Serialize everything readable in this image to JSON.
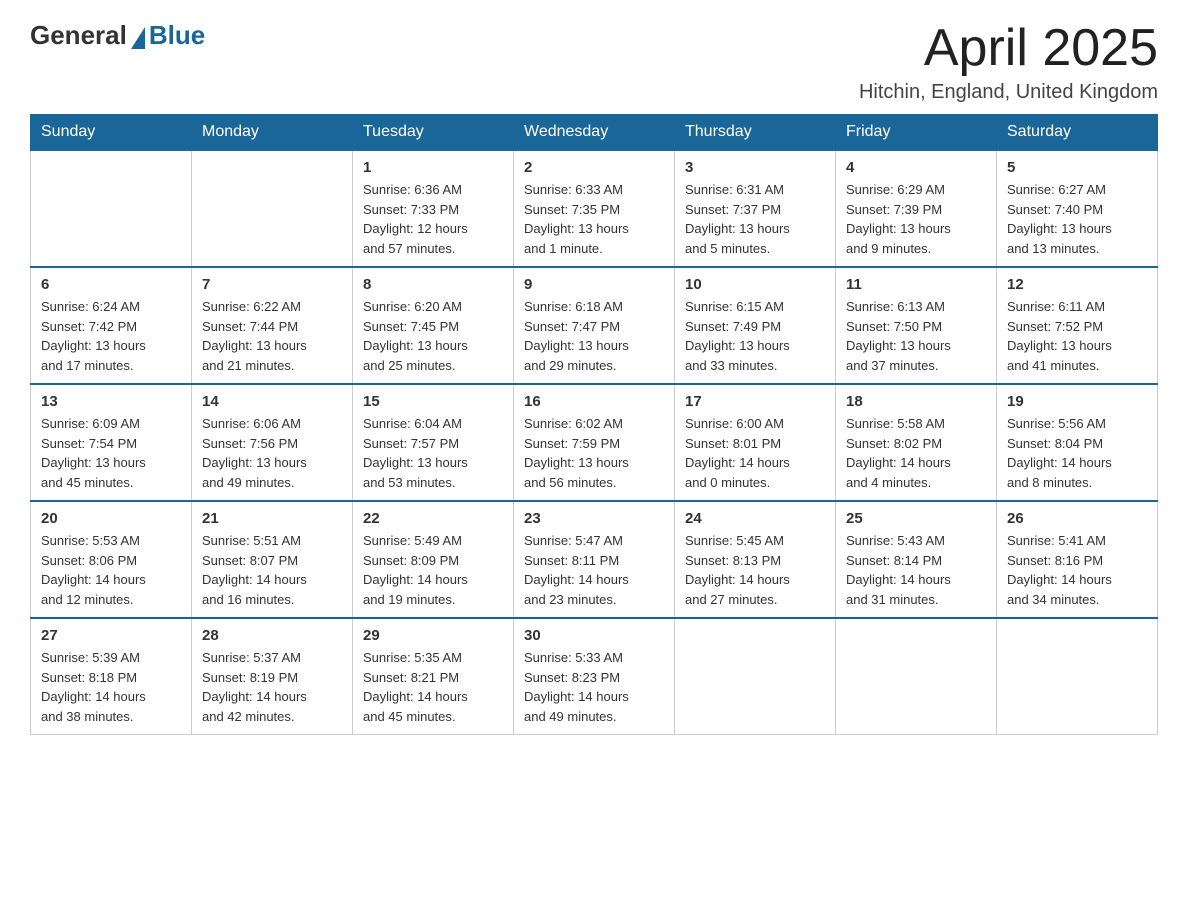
{
  "header": {
    "logo": {
      "general": "General",
      "blue": "Blue"
    },
    "title": "April 2025",
    "location": "Hitchin, England, United Kingdom"
  },
  "days_of_week": [
    "Sunday",
    "Monday",
    "Tuesday",
    "Wednesday",
    "Thursday",
    "Friday",
    "Saturday"
  ],
  "weeks": [
    [
      {
        "day": "",
        "info": ""
      },
      {
        "day": "",
        "info": ""
      },
      {
        "day": "1",
        "info": "Sunrise: 6:36 AM\nSunset: 7:33 PM\nDaylight: 12 hours\nand 57 minutes."
      },
      {
        "day": "2",
        "info": "Sunrise: 6:33 AM\nSunset: 7:35 PM\nDaylight: 13 hours\nand 1 minute."
      },
      {
        "day": "3",
        "info": "Sunrise: 6:31 AM\nSunset: 7:37 PM\nDaylight: 13 hours\nand 5 minutes."
      },
      {
        "day": "4",
        "info": "Sunrise: 6:29 AM\nSunset: 7:39 PM\nDaylight: 13 hours\nand 9 minutes."
      },
      {
        "day": "5",
        "info": "Sunrise: 6:27 AM\nSunset: 7:40 PM\nDaylight: 13 hours\nand 13 minutes."
      }
    ],
    [
      {
        "day": "6",
        "info": "Sunrise: 6:24 AM\nSunset: 7:42 PM\nDaylight: 13 hours\nand 17 minutes."
      },
      {
        "day": "7",
        "info": "Sunrise: 6:22 AM\nSunset: 7:44 PM\nDaylight: 13 hours\nand 21 minutes."
      },
      {
        "day": "8",
        "info": "Sunrise: 6:20 AM\nSunset: 7:45 PM\nDaylight: 13 hours\nand 25 minutes."
      },
      {
        "day": "9",
        "info": "Sunrise: 6:18 AM\nSunset: 7:47 PM\nDaylight: 13 hours\nand 29 minutes."
      },
      {
        "day": "10",
        "info": "Sunrise: 6:15 AM\nSunset: 7:49 PM\nDaylight: 13 hours\nand 33 minutes."
      },
      {
        "day": "11",
        "info": "Sunrise: 6:13 AM\nSunset: 7:50 PM\nDaylight: 13 hours\nand 37 minutes."
      },
      {
        "day": "12",
        "info": "Sunrise: 6:11 AM\nSunset: 7:52 PM\nDaylight: 13 hours\nand 41 minutes."
      }
    ],
    [
      {
        "day": "13",
        "info": "Sunrise: 6:09 AM\nSunset: 7:54 PM\nDaylight: 13 hours\nand 45 minutes."
      },
      {
        "day": "14",
        "info": "Sunrise: 6:06 AM\nSunset: 7:56 PM\nDaylight: 13 hours\nand 49 minutes."
      },
      {
        "day": "15",
        "info": "Sunrise: 6:04 AM\nSunset: 7:57 PM\nDaylight: 13 hours\nand 53 minutes."
      },
      {
        "day": "16",
        "info": "Sunrise: 6:02 AM\nSunset: 7:59 PM\nDaylight: 13 hours\nand 56 minutes."
      },
      {
        "day": "17",
        "info": "Sunrise: 6:00 AM\nSunset: 8:01 PM\nDaylight: 14 hours\nand 0 minutes."
      },
      {
        "day": "18",
        "info": "Sunrise: 5:58 AM\nSunset: 8:02 PM\nDaylight: 14 hours\nand 4 minutes."
      },
      {
        "day": "19",
        "info": "Sunrise: 5:56 AM\nSunset: 8:04 PM\nDaylight: 14 hours\nand 8 minutes."
      }
    ],
    [
      {
        "day": "20",
        "info": "Sunrise: 5:53 AM\nSunset: 8:06 PM\nDaylight: 14 hours\nand 12 minutes."
      },
      {
        "day": "21",
        "info": "Sunrise: 5:51 AM\nSunset: 8:07 PM\nDaylight: 14 hours\nand 16 minutes."
      },
      {
        "day": "22",
        "info": "Sunrise: 5:49 AM\nSunset: 8:09 PM\nDaylight: 14 hours\nand 19 minutes."
      },
      {
        "day": "23",
        "info": "Sunrise: 5:47 AM\nSunset: 8:11 PM\nDaylight: 14 hours\nand 23 minutes."
      },
      {
        "day": "24",
        "info": "Sunrise: 5:45 AM\nSunset: 8:13 PM\nDaylight: 14 hours\nand 27 minutes."
      },
      {
        "day": "25",
        "info": "Sunrise: 5:43 AM\nSunset: 8:14 PM\nDaylight: 14 hours\nand 31 minutes."
      },
      {
        "day": "26",
        "info": "Sunrise: 5:41 AM\nSunset: 8:16 PM\nDaylight: 14 hours\nand 34 minutes."
      }
    ],
    [
      {
        "day": "27",
        "info": "Sunrise: 5:39 AM\nSunset: 8:18 PM\nDaylight: 14 hours\nand 38 minutes."
      },
      {
        "day": "28",
        "info": "Sunrise: 5:37 AM\nSunset: 8:19 PM\nDaylight: 14 hours\nand 42 minutes."
      },
      {
        "day": "29",
        "info": "Sunrise: 5:35 AM\nSunset: 8:21 PM\nDaylight: 14 hours\nand 45 minutes."
      },
      {
        "day": "30",
        "info": "Sunrise: 5:33 AM\nSunset: 8:23 PM\nDaylight: 14 hours\nand 49 minutes."
      },
      {
        "day": "",
        "info": ""
      },
      {
        "day": "",
        "info": ""
      },
      {
        "day": "",
        "info": ""
      }
    ]
  ]
}
